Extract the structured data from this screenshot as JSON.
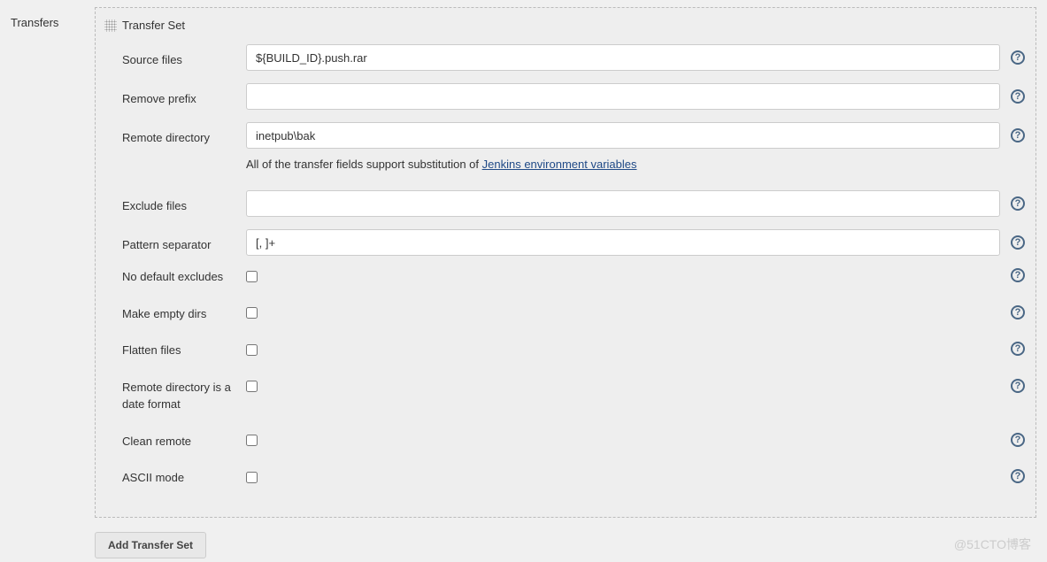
{
  "section": {
    "title": "Transfers"
  },
  "transferSet": {
    "header": "Transfer Set",
    "sourceFiles": {
      "label": "Source files",
      "value": "${BUILD_ID}.push.rar"
    },
    "removePrefix": {
      "label": "Remove prefix",
      "value": ""
    },
    "remoteDirectory": {
      "label": "Remote directory",
      "value": "inetpub\\bak"
    },
    "helpNote": {
      "prefix": "All of the transfer fields support substitution of ",
      "linkText": "Jenkins environment variables"
    },
    "excludeFiles": {
      "label": "Exclude files",
      "value": ""
    },
    "patternSeparator": {
      "label": "Pattern separator",
      "value": "[, ]+"
    },
    "noDefaultExcludes": {
      "label": "No default excludes",
      "checked": false
    },
    "makeEmptyDirs": {
      "label": "Make empty dirs",
      "checked": false
    },
    "flattenFiles": {
      "label": "Flatten files",
      "checked": false
    },
    "remoteDirIsDate": {
      "label": "Remote directory is a date format",
      "checked": false
    },
    "cleanRemote": {
      "label": "Clean remote",
      "checked": false
    },
    "asciiMode": {
      "label": "ASCII mode",
      "checked": false
    }
  },
  "actions": {
    "addTransferSet": "Add Transfer Set"
  },
  "watermark": "@51CTO博客"
}
